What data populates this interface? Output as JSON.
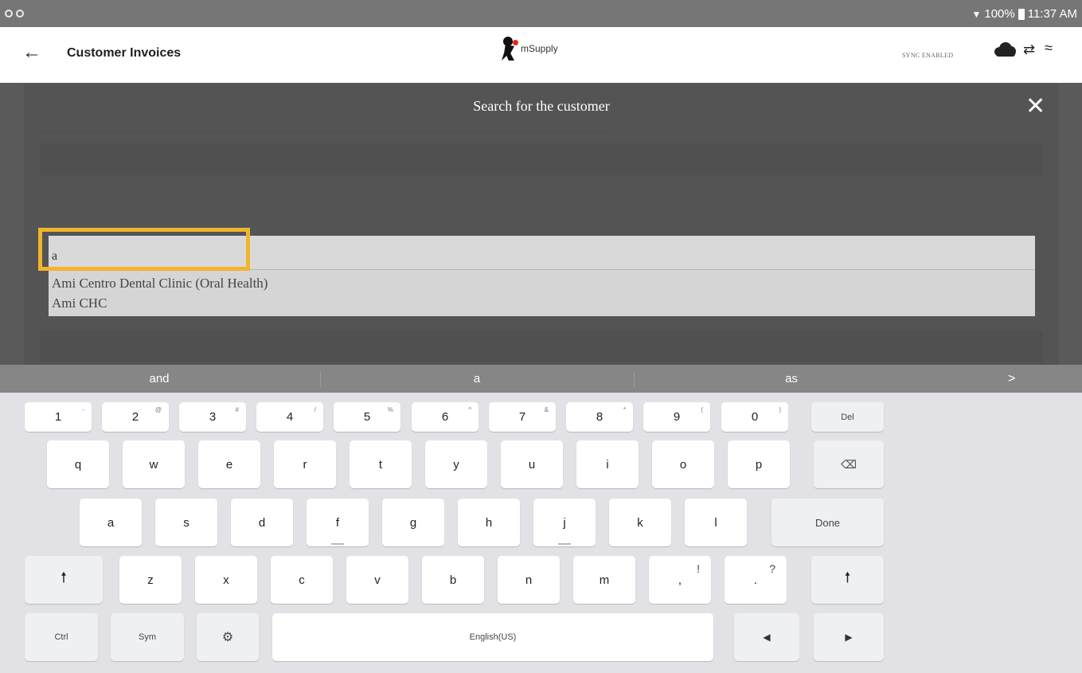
{
  "status": {
    "time": "11:37 AM",
    "battery": "100%"
  },
  "header": {
    "title": "Customer Invoices",
    "logo": "mSupply",
    "sync": "SYNC ENABLED",
    "icons": [
      "back-arrow-icon",
      "cloud-icon",
      "sync-arrows-icon",
      "rss-icon"
    ]
  },
  "modal": {
    "title": "Search for the customer",
    "input_value": "a",
    "results": [
      "Ami Centro Dental Clinic (Oral Health)",
      "Ami CHC"
    ],
    "colors": {
      "highlight": "#f1b52c",
      "overlay": "#545454"
    }
  },
  "keyboard": {
    "suggestions": [
      "and",
      "a",
      "as"
    ],
    "more": ">",
    "row1": [
      {
        "k": "1",
        "s": "-"
      },
      {
        "k": "2",
        "s": "@"
      },
      {
        "k": "3",
        "s": "#"
      },
      {
        "k": "4",
        "s": "/"
      },
      {
        "k": "5",
        "s": "%"
      },
      {
        "k": "6",
        "s": "^"
      },
      {
        "k": "7",
        "s": "&"
      },
      {
        "k": "8",
        "s": "*"
      },
      {
        "k": "9",
        "s": "("
      },
      {
        "k": "0",
        "s": ")"
      }
    ],
    "del": "Del",
    "row2": [
      "q",
      "w",
      "e",
      "r",
      "t",
      "y",
      "u",
      "i",
      "o",
      "p"
    ],
    "row3": [
      "a",
      "s",
      "d",
      "f",
      "g",
      "h",
      "j",
      "k",
      "l"
    ],
    "done": "Done",
    "row4": [
      "z",
      "x",
      "c",
      "v",
      "b",
      "n",
      "m"
    ],
    "comma": ",",
    "comma_sub": "!",
    "period": ".",
    "period_sub": "?",
    "ctrl": "Ctrl",
    "sym": "Sym",
    "space": "English(US)"
  }
}
